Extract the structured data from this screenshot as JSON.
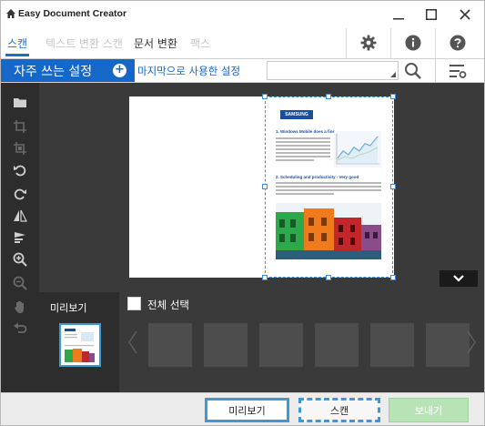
{
  "window": {
    "title": "Easy Document Creator"
  },
  "tabs": [
    {
      "label": "스캔",
      "active": true
    },
    {
      "label": "텍스트 변환 스캔",
      "active": false
    },
    {
      "label": "문서 변환",
      "active": false
    },
    {
      "label": "팩스",
      "active": false
    }
  ],
  "band": {
    "favorites_label": "자주 쓰는 설정",
    "add_symbol": "+",
    "last_used_label": "마지막으로 사용한 설정",
    "dropdown_value": ""
  },
  "document": {
    "logo_text": "SAMSUNG",
    "heading1": "1. Windows Mobile does a fine",
    "heading2": "2. Scheduling and productivity - Very good"
  },
  "preview": {
    "label": "미리보기"
  },
  "gallery": {
    "select_all_label": "전체 선택",
    "slot_count": 6
  },
  "buttons": {
    "preview": "미리보기",
    "scan": "스캔",
    "send": "보내기"
  },
  "colors": {
    "accent": "#1567c8",
    "selection": "#3a9ad8",
    "toolbar_bg": "#2d2d2d",
    "canvas_bg": "#3a3a3a"
  },
  "sidebar_icons": [
    "folder-open-icon",
    "crop-multi-icon",
    "crop-icon",
    "rotate-left-icon",
    "rotate-right-icon",
    "flip-icon",
    "flag-icon",
    "zoom-in-icon",
    "zoom-out-icon",
    "hand-icon",
    "undo-icon"
  ]
}
